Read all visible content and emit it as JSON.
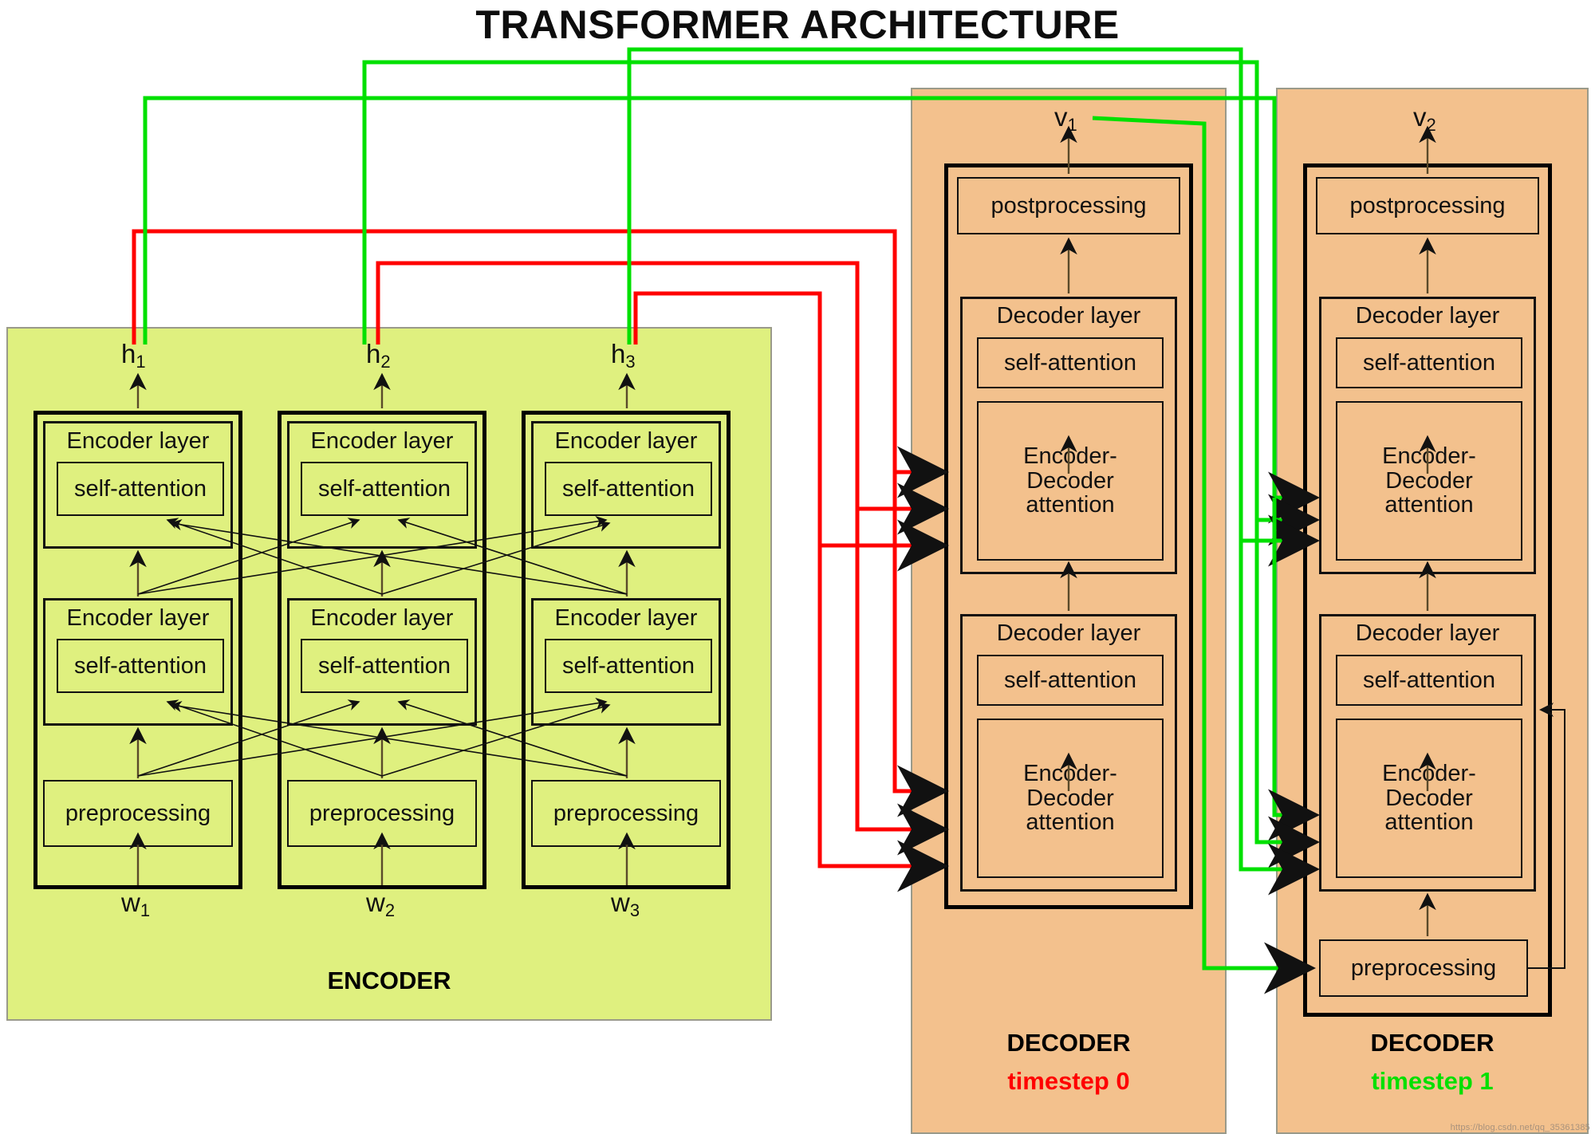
{
  "title": "TRANSFORMER ARCHITECTURE",
  "colors": {
    "encoder_bg": "#dff07f",
    "decoder_bg": "#f3c18d",
    "timestep0": "#ff0000",
    "timestep1": "#00e000",
    "box_stroke": "#000000",
    "page_bg": "#ffffff"
  },
  "encoder": {
    "caption": "ENCODER",
    "outputs": [
      {
        "base": "h",
        "sub": "1"
      },
      {
        "base": "h",
        "sub": "2"
      },
      {
        "base": "h",
        "sub": "3"
      }
    ],
    "inputs": [
      {
        "base": "w",
        "sub": "1"
      },
      {
        "base": "w",
        "sub": "2"
      },
      {
        "base": "w",
        "sub": "3"
      }
    ],
    "columns": [
      {
        "layers": [
          {
            "title": "Encoder layer",
            "inner": "self-attention"
          },
          {
            "title": "Encoder layer",
            "inner": "self-attention"
          }
        ],
        "preprocessing": "preprocessing"
      },
      {
        "layers": [
          {
            "title": "Encoder layer",
            "inner": "self-attention"
          },
          {
            "title": "Encoder layer",
            "inner": "self-attention"
          }
        ],
        "preprocessing": "preprocessing"
      },
      {
        "layers": [
          {
            "title": "Encoder layer",
            "inner": "self-attention"
          },
          {
            "title": "Encoder layer",
            "inner": "self-attention"
          }
        ],
        "preprocessing": "preprocessing"
      }
    ]
  },
  "decoders": [
    {
      "caption": "DECODER",
      "timestep_label": "timestep 0",
      "timestep_color": "#ff0000",
      "output": {
        "base": "v",
        "sub": "1"
      },
      "postprocessing": "postprocessing",
      "layers": [
        {
          "title": "Decoder layer",
          "self_attention": "self-attention",
          "cross_attention": "Encoder-\nDecoder\nattention"
        },
        {
          "title": "Decoder layer",
          "self_attention": "self-attention",
          "cross_attention": "Encoder-\nDecoder\nattention"
        }
      ],
      "has_preprocessing": false,
      "preprocessing": ""
    },
    {
      "caption": "DECODER",
      "timestep_label": "timestep 1",
      "timestep_color": "#00e000",
      "output": {
        "base": "v",
        "sub": "2"
      },
      "postprocessing": "postprocessing",
      "layers": [
        {
          "title": "Decoder layer",
          "self_attention": "self-attention",
          "cross_attention": "Encoder-\nDecoder\nattention"
        },
        {
          "title": "Decoder layer",
          "self_attention": "self-attention",
          "cross_attention": "Encoder-\nDecoder\nattention"
        }
      ],
      "has_preprocessing": true,
      "preprocessing": "preprocessing"
    }
  ],
  "cross_attention_line1": "Encoder-",
  "cross_attention_line2": "Decoder",
  "cross_attention_line3": "attention",
  "watermark": "https://blog.csdn.net/qq_35361385"
}
